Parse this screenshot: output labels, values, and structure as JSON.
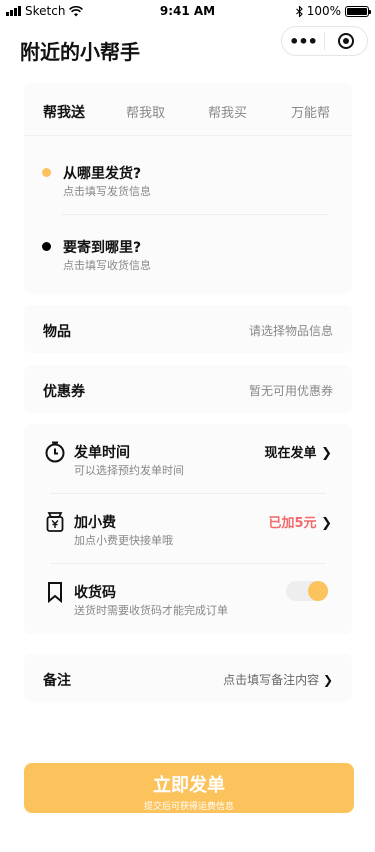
{
  "status_bar": {
    "carrier": "Sketch",
    "time": "9:41 AM",
    "battery": "100%"
  },
  "nav": {
    "title": "附近的小帮手"
  },
  "tabs": [
    {
      "label": "帮我送",
      "active": true
    },
    {
      "label": "帮我取",
      "active": false
    },
    {
      "label": "帮我买",
      "active": false
    },
    {
      "label": "万能帮",
      "active": false
    }
  ],
  "addresses": [
    {
      "title": "从哪里发货?",
      "subtitle": "点击填写发货信息",
      "dot_color": "#fcc35d"
    },
    {
      "title": "要寄到哪里?",
      "subtitle": "点击填写收货信息",
      "dot_color": "#000000"
    }
  ],
  "item_row": {
    "label": "物品",
    "value": "请选择物品信息"
  },
  "coupon_row": {
    "label": "优惠券",
    "value": "暂无可用优惠券"
  },
  "options": {
    "time": {
      "title": "发单时间",
      "subtitle": "可以选择预约发单时间",
      "action": "现在发单",
      "icon": "clock-icon"
    },
    "tip": {
      "title": "加小费",
      "subtitle": "加点小费更快接单哦",
      "action": "已加5元",
      "icon": "money-bag-icon"
    },
    "code": {
      "title": "收货码",
      "subtitle": "送货时需要收货码才能完成订单",
      "icon": "bookmark-icon",
      "toggle_on": true
    }
  },
  "remark_row": {
    "label": "备注",
    "value": "点击填写备注内容"
  },
  "submit": {
    "label": "立即发单",
    "hint": "提交后可获得运费信息"
  },
  "colors": {
    "accent": "#fcc35d",
    "price_red": "#f06a6a",
    "card_bg": "#fbfbfb"
  }
}
